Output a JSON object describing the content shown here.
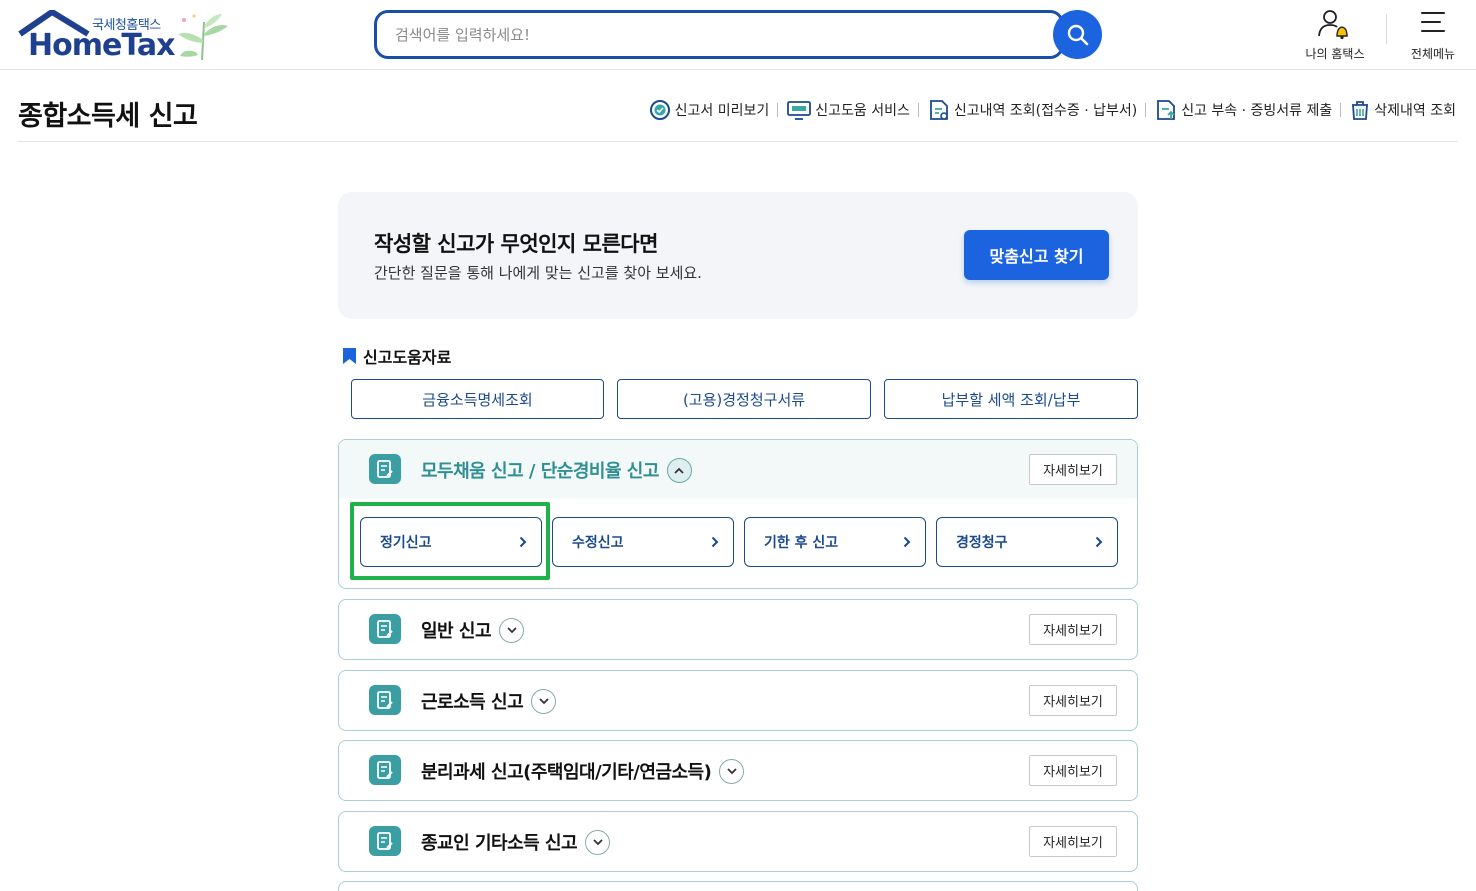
{
  "header": {
    "logo_kr": "국세청홈택스",
    "logo_en": "HomeTax",
    "search_placeholder": "검색어를 입력하세요!",
    "my_hometax": "나의 홈택스",
    "all_menu": "전체메뉴"
  },
  "page": {
    "title": "종합소득세 신고",
    "quick_links": [
      {
        "label": "신고서 미리보기",
        "icon": "check-circle-icon"
      },
      {
        "label": "신고도움 서비스",
        "icon": "monitor-icon"
      },
      {
        "label": "신고내역 조회(접수증 · 납부서)",
        "icon": "document-search-icon"
      },
      {
        "label": "신고 부속 · 증빙서류 제출",
        "icon": "document-upload-icon"
      },
      {
        "label": "삭제내역 조회",
        "icon": "trash-icon"
      }
    ]
  },
  "guide": {
    "heading": "작성할 신고가 무엇인지 모른다면",
    "subtext": "간단한 질문을 통해 나에게 맞는 신고를 찾아 보세요.",
    "button": "맞춤신고 찾기"
  },
  "help": {
    "title": "신고도움자료",
    "buttons": [
      "금융소득명세조회",
      "(고용)경정청구서류",
      "납부할 세액 조회/납부"
    ]
  },
  "sections": [
    {
      "title": "모두채움 신고 / 단순경비율 신고",
      "more": "자세히보기",
      "expanded": true,
      "sub_buttons": [
        "정기신고",
        "수정신고",
        "기한 후 신고",
        "경정청구"
      ]
    },
    {
      "title": "일반 신고",
      "more": "자세히보기",
      "expanded": false
    },
    {
      "title": "근로소득 신고",
      "more": "자세히보기",
      "expanded": false
    },
    {
      "title": "분리과세 신고(주택임대/기타/연금소득)",
      "more": "자세히보기",
      "expanded": false
    },
    {
      "title": "종교인 기타소득 신고",
      "more": "자세히보기",
      "expanded": false
    }
  ],
  "colors": {
    "brand_blue": "#1c63e0",
    "navy": "#1a4a8f",
    "teal": "#3a9ea3",
    "highlight_green": "#1fb24a"
  }
}
